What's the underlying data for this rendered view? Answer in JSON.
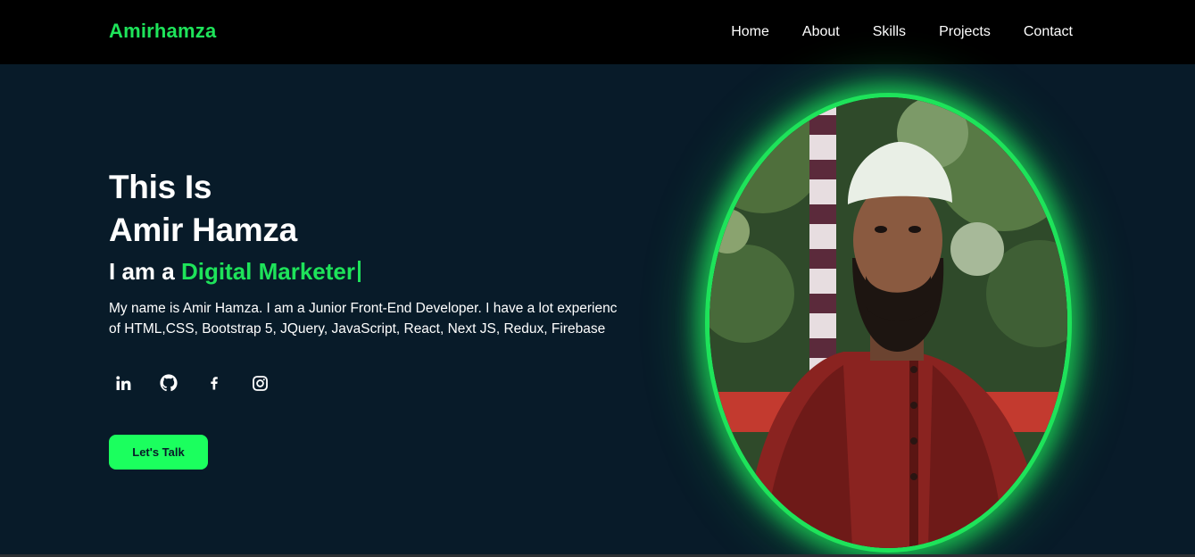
{
  "header": {
    "logo": "Amirhamza",
    "nav": [
      {
        "label": "Home"
      },
      {
        "label": "About"
      },
      {
        "label": "Skills"
      },
      {
        "label": "Projects"
      },
      {
        "label": "Contact"
      }
    ]
  },
  "hero": {
    "line1": "This Is",
    "line2": "Amir Hamza",
    "role_prefix": "I am a ",
    "role_accent": "Digital Marketer",
    "description": "My name is Amir Hamza. I am a Junior Front-End Developer. I have a lot experienc of HTML,CSS, Bootstrap 5, JQuery, JavaScript, React, Next JS, Redux, Firebase",
    "socials": [
      {
        "icon": "linkedin-icon"
      },
      {
        "icon": "github-icon"
      },
      {
        "icon": "facebook-icon"
      },
      {
        "icon": "instagram-icon"
      }
    ],
    "cta_label": "Let's Talk"
  },
  "colors": {
    "background": "#081b29",
    "header": "#000000",
    "accent": "#1ee35a",
    "button": "#1bff5e",
    "text": "#ffffff"
  }
}
